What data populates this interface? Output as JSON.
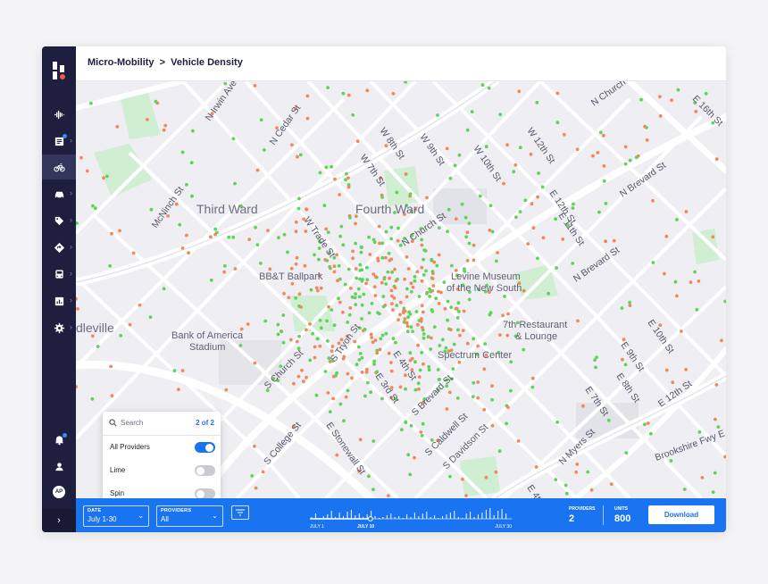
{
  "breadcrumb": {
    "parent": "Micro-Mobility",
    "separator": ">",
    "current": "Vehicle Density"
  },
  "sidebar": {
    "items": [
      {
        "icon": "activity-icon"
      },
      {
        "icon": "document-icon",
        "badge": true
      },
      {
        "icon": "bicycle-icon",
        "active": true
      },
      {
        "icon": "car-icon"
      },
      {
        "icon": "tag-icon"
      },
      {
        "icon": "directions-icon"
      },
      {
        "icon": "bus-icon"
      },
      {
        "icon": "bar-chart-icon"
      },
      {
        "icon": "gear-icon"
      }
    ],
    "notification_icon": "bell-icon",
    "user_icon": "user-icon",
    "avatar_initials": "AP",
    "collapse_icon": "chevron-right-icon"
  },
  "map": {
    "areas": [
      "Third Ward",
      "Fourth Ward",
      "dleville"
    ],
    "places": [
      "BB&T Ballpark",
      "Levine Museum",
      "of the New South",
      "Bank of America",
      "Stadium",
      "7th Restaurant",
      "& Lounge",
      "Spectrum Center"
    ],
    "streets": [
      "N Irwin Ave",
      "N Cedar St",
      "W 8th St",
      "W 9th St",
      "W 10th St",
      "W 12th St",
      "N Church St",
      "E 16th St",
      "W 7th St",
      "McNinch St",
      "W Trade St",
      "E 12th St",
      "E 11th St",
      "N Brevard St",
      "N Church St",
      "N Brevard St",
      "E 10th St",
      "E 9th St",
      "E 8th St",
      "E 12th St",
      "S Church St",
      "S Tryon St",
      "E 3rd St",
      "E 4th St",
      "E 7th St",
      "E Stonewall St",
      "S College St",
      "S Brevard St",
      "S Caldwell St",
      "S Davidson St",
      "N Myers St",
      "Brookshire Fwy E",
      "E 4th St"
    ],
    "colors": {
      "orange": "#f08a5d",
      "green": "#5fd35a",
      "background": "#eeeef3",
      "road": "#ffffff",
      "park": "#cfeed2"
    }
  },
  "filter_panel": {
    "search_placeholder": "Search",
    "count": "2 of 2",
    "options": [
      {
        "label": "All Providers",
        "enabled": true
      },
      {
        "label": "Lime",
        "enabled": false
      },
      {
        "label": "Spin",
        "enabled": false
      }
    ]
  },
  "bottom_bar": {
    "date_label": "DATE",
    "date_value": "July 1-30",
    "providers_label": "PROVIDERS",
    "providers_value": "All",
    "filter_icon": "filter-icon",
    "timeline": {
      "start_label": "JULY 1",
      "current_label": "JULY 10",
      "end_label": "JULY 30",
      "position_fraction": 0.3
    },
    "stats": [
      {
        "label": "PROVIDERS",
        "value": "2"
      },
      {
        "label": "UNITS",
        "value": "800"
      }
    ],
    "download_label": "Download"
  },
  "accent_color": "#1a73f0",
  "sidebar_color": "#1e1f3f"
}
